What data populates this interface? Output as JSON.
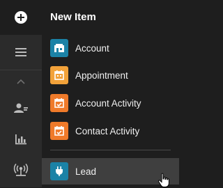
{
  "menu": {
    "title": "New Item",
    "items": [
      {
        "label": "Account",
        "icon": "account-icon",
        "color": "#1b82a6"
      },
      {
        "label": "Appointment",
        "icon": "calendar-icon",
        "color": "#f2a23a"
      },
      {
        "label": "Account Activity",
        "icon": "calendar-check-icon",
        "color": "#ef7a2a"
      },
      {
        "label": "Contact Activity",
        "icon": "calendar-check-icon",
        "color": "#ef7a2a"
      },
      {
        "label": "Lead",
        "icon": "plug-icon",
        "color": "#1b82a6"
      }
    ]
  },
  "rail": {
    "icons": [
      "new-item-icon",
      "hamburger-menu-icon",
      "chevron-up-icon",
      "contacts-icon",
      "bar-chart-icon",
      "broadcast-icon"
    ]
  },
  "colors": {
    "background": "#1e1e1e",
    "rail": "#2b2b2b",
    "hover": "#3f3f3f",
    "text": "#ffffff"
  }
}
